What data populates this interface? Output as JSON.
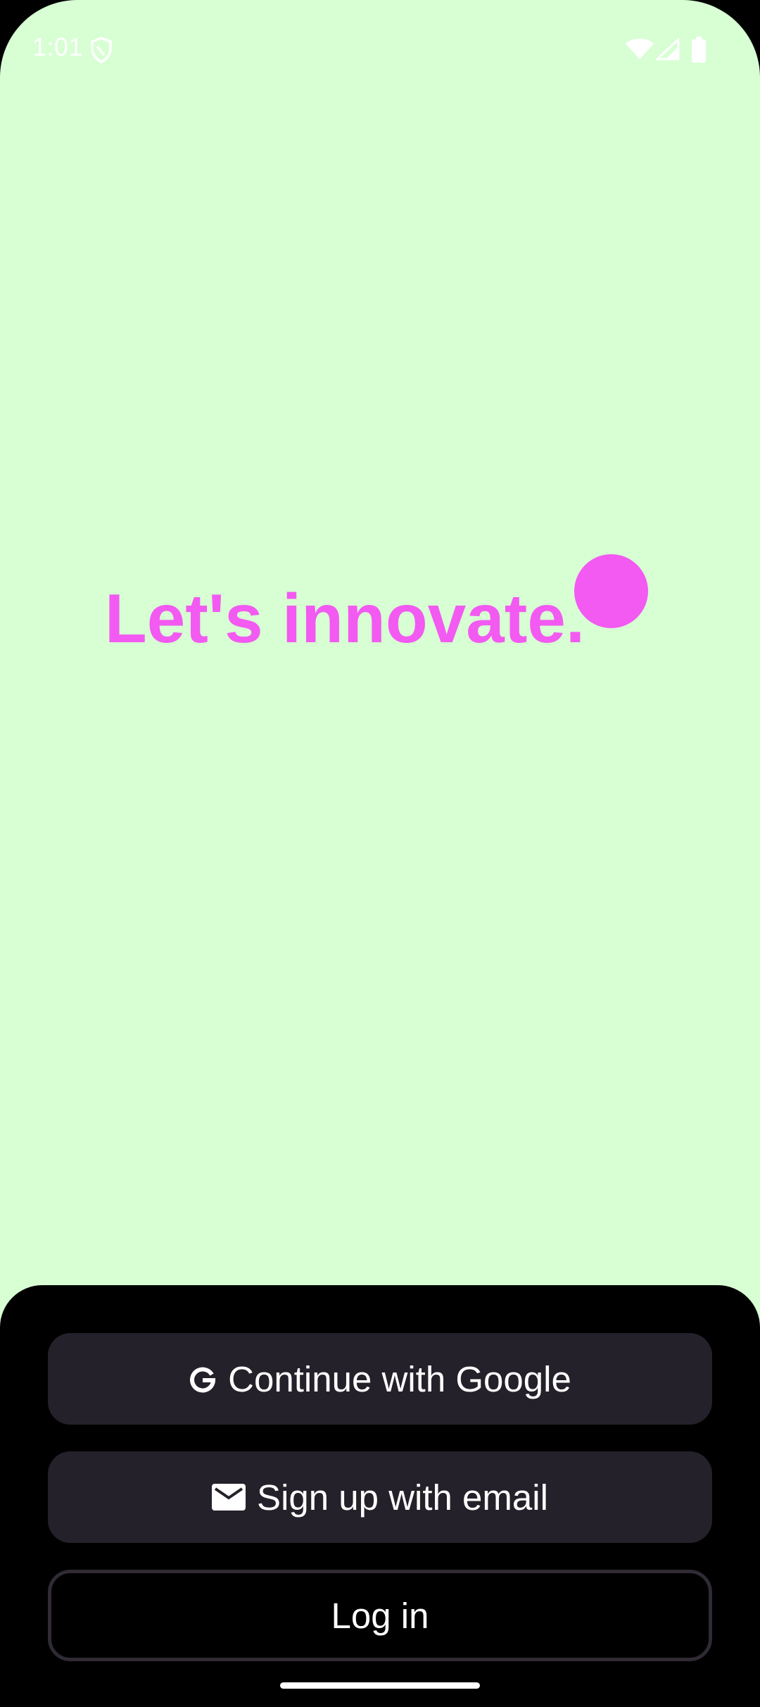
{
  "status_bar": {
    "time": "1:01",
    "icons": [
      "shield-icon",
      "wifi-icon",
      "signal-icon",
      "battery-icon"
    ]
  },
  "main": {
    "headline": "Let's innovate.",
    "accent_color": "#f25af1",
    "background_color": "#d7ffd3"
  },
  "actions": {
    "google_label": "Continue with Google",
    "google_icon": "google-g-icon",
    "email_label": "Sign up with email",
    "email_icon": "mail-icon",
    "login_label": "Log in"
  }
}
